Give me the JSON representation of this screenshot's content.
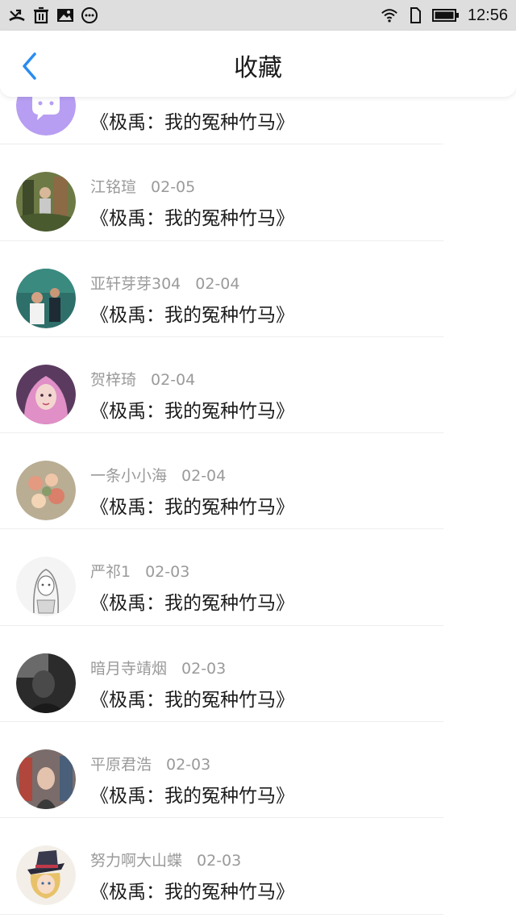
{
  "status_bar": {
    "time": "12:56",
    "icons": [
      "missed-call-icon",
      "trash-icon",
      "image-icon",
      "more-circle-icon",
      "wifi-icon",
      "sim-icon",
      "battery-icon"
    ]
  },
  "nav": {
    "title": "收藏",
    "back_icon": "chevron-left-icon",
    "accent": "#2a8cf0"
  },
  "items": [
    {
      "name": "",
      "date": "",
      "title": "《极禹：我的冤种竹马》",
      "avatar": "chat-bubble-icon",
      "avatar_color": "#b79ef2"
    },
    {
      "name": "江铭瑄",
      "date": "02-05",
      "title": "《极禹：我的冤种竹马》",
      "avatar": "photo-forest",
      "avatar_color": "#6d7a45"
    },
    {
      "name": "亚轩芽芽304",
      "date": "02-04",
      "title": "《极禹：我的冤种竹马》",
      "avatar": "photo-people",
      "avatar_color": "#2e6f6a"
    },
    {
      "name": "贺梓琦",
      "date": "02-04",
      "title": "《极禹：我的冤种竹马》",
      "avatar": "photo-girl-pink",
      "avatar_color": "#c47ab0"
    },
    {
      "name": "一条小小海",
      "date": "02-04",
      "title": "《极禹：我的冤种竹马》",
      "avatar": "photo-flowers",
      "avatar_color": "#c9a58f"
    },
    {
      "name": "严祁1",
      "date": "02-03",
      "title": "《极禹：我的冤种竹马》",
      "avatar": "drawing-sketch",
      "avatar_color": "#e9e9e9"
    },
    {
      "name": "暗月寺靖烟",
      "date": "02-03",
      "title": "《极禹：我的冤种竹马》",
      "avatar": "photo-dark",
      "avatar_color": "#2b2b2b"
    },
    {
      "name": "平原君浩",
      "date": "02-03",
      "title": "《极禹：我的冤种竹马》",
      "avatar": "photo-shop",
      "avatar_color": "#6b5a5a"
    },
    {
      "name": "努力啊大山蝶",
      "date": "02-03",
      "title": "《极禹：我的冤种竹马》",
      "avatar": "drawing-hat",
      "avatar_color": "#e8c26a"
    }
  ]
}
